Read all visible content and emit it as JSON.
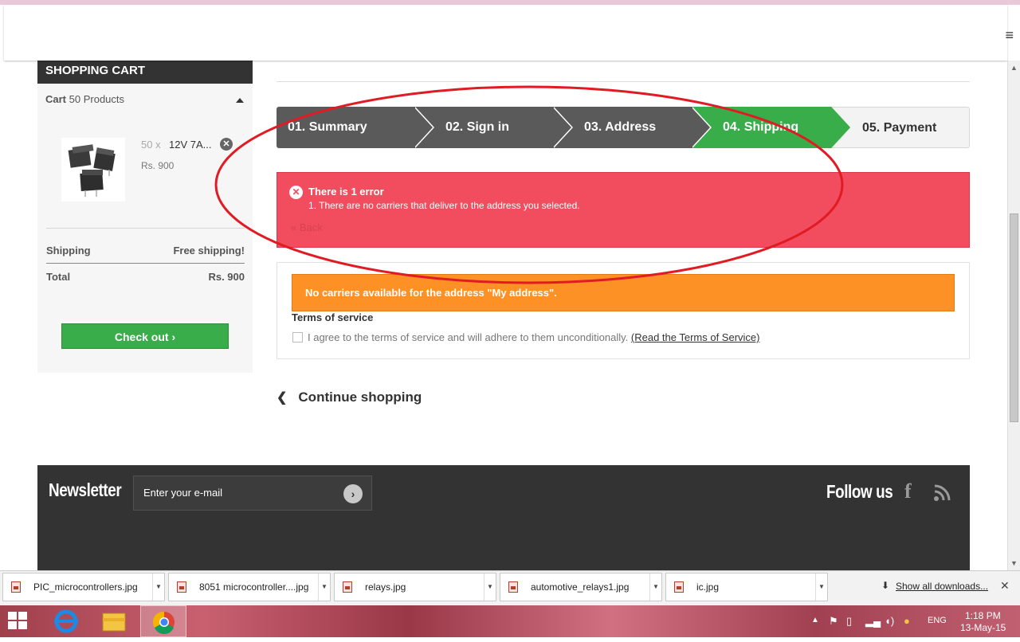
{
  "cart": {
    "heading": "SHOPPING CART",
    "count_label": "Cart",
    "count_value": "50 Products",
    "product": {
      "qty": "50 x",
      "name": "12V 7A...",
      "price": "Rs. 900"
    },
    "shipping_label": "Shipping",
    "shipping_value": "Free shipping!",
    "total_label": "Total",
    "total_value": "Rs. 900",
    "checkout_label": "Check out ›"
  },
  "steps": [
    "01. Summary",
    "02. Sign in",
    "03. Address",
    "04. Shipping",
    "05. Payment"
  ],
  "active_step": "04. Shipping",
  "error": {
    "title": "There is 1 error",
    "message": "1.  There are no carriers that deliver to the address you selected.",
    "back": "« Back"
  },
  "carrier": {
    "warning": "No carriers available for the address \"My address\".",
    "tos_title": "Terms of service",
    "tos_text": "I agree to the terms of service and will adhere to them unconditionally.",
    "tos_link": "(Read the Terms of Service)"
  },
  "continue_label": "Continue shopping",
  "footer": {
    "newsletter": "Newsletter",
    "email_placeholder": "Enter your e-mail",
    "follow": "Follow us"
  },
  "downloads": [
    {
      "name": "PIC_microcontrollers.jpg"
    },
    {
      "name": "8051 microcontroller....jpg"
    },
    {
      "name": "relays.jpg"
    },
    {
      "name": "automotive_relays1.jpg"
    },
    {
      "name": "ic.jpg"
    }
  ],
  "show_all": "Show all downloads...",
  "taskbar": {
    "lang": "ENG",
    "time": "1:18 PM",
    "date": "13-May-15"
  },
  "colors": {
    "accent_green": "#3aad4b",
    "error_red": "#f24d5e",
    "warning_orange": "#fe9126",
    "footer_dark": "#333333"
  }
}
